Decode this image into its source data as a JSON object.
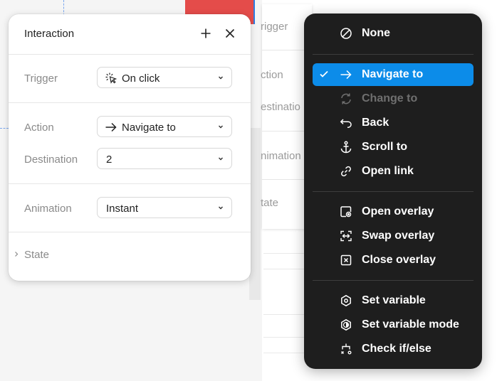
{
  "interaction_panel": {
    "title": "Interaction",
    "add_icon": "plus-icon",
    "close_icon": "close-icon",
    "trigger": {
      "label": "Trigger",
      "value": "On click",
      "icon": "click-icon"
    },
    "action": {
      "label": "Action",
      "value": "Navigate to",
      "icon": "arrow-right-icon"
    },
    "destination": {
      "label": "Destination",
      "value": "2"
    },
    "animation": {
      "label": "Animation",
      "value": "Instant"
    },
    "state": {
      "label": "State"
    }
  },
  "background_panel": {
    "labels": [
      "rigger",
      "ction",
      "estinatio",
      "nimation",
      "tate"
    ]
  },
  "action_menu": {
    "groups": [
      [
        {
          "label": "None",
          "icon": "none-icon",
          "selected": false,
          "disabled": false
        }
      ],
      [
        {
          "label": "Navigate to",
          "icon": "arrow-right-icon",
          "selected": true,
          "disabled": false
        },
        {
          "label": "Change to",
          "icon": "change-icon",
          "selected": false,
          "disabled": true
        },
        {
          "label": "Back",
          "icon": "back-icon",
          "selected": false,
          "disabled": false
        },
        {
          "label": "Scroll to",
          "icon": "anchor-icon",
          "selected": false,
          "disabled": false
        },
        {
          "label": "Open link",
          "icon": "link-icon",
          "selected": false,
          "disabled": false
        }
      ],
      [
        {
          "label": "Open overlay",
          "icon": "open-overlay-icon",
          "selected": false,
          "disabled": false
        },
        {
          "label": "Swap overlay",
          "icon": "swap-overlay-icon",
          "selected": false,
          "disabled": false
        },
        {
          "label": "Close overlay",
          "icon": "close-overlay-icon",
          "selected": false,
          "disabled": false
        }
      ],
      [
        {
          "label": "Set variable",
          "icon": "variable-icon",
          "selected": false,
          "disabled": false
        },
        {
          "label": "Set variable mode",
          "icon": "variable-mode-icon",
          "selected": false,
          "disabled": false
        },
        {
          "label": "Check if/else",
          "icon": "conditional-icon",
          "selected": false,
          "disabled": false
        }
      ]
    ]
  },
  "colors": {
    "accent": "#0c8ce9",
    "menu_bg": "#1e1e1e",
    "disabled_text": "#6f6f6f",
    "label_grey": "#8a8a8a"
  }
}
